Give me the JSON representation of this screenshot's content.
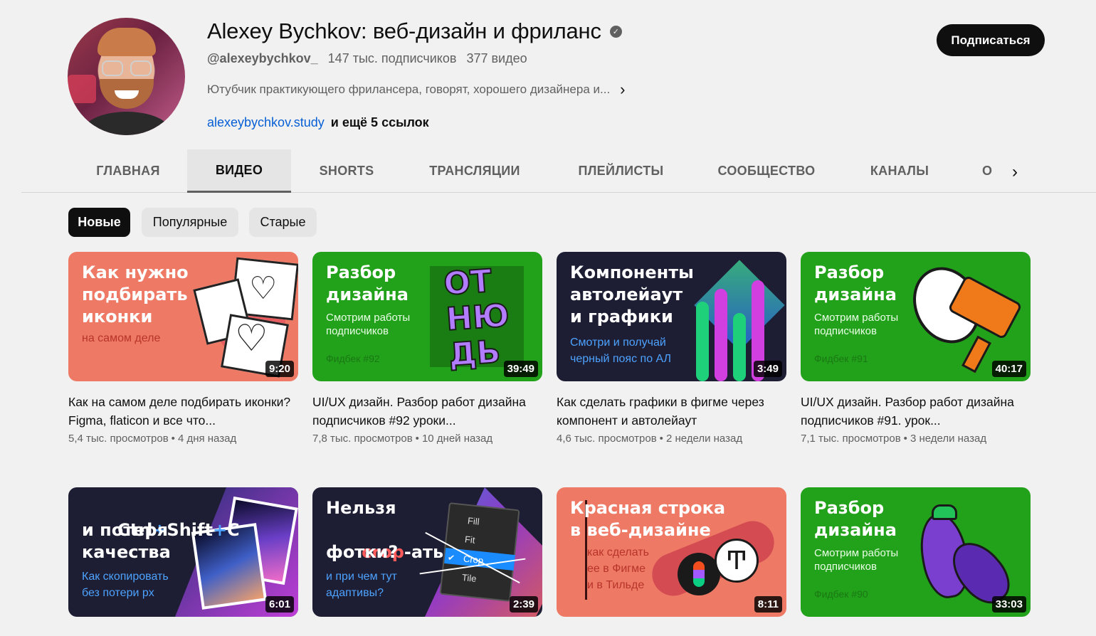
{
  "channel": {
    "title": "Alexey Bychkov: веб-дизайн и фриланс",
    "verified_glyph": "✓",
    "handle": "@alexeybychkov_",
    "subscribers": "147 тыс. подписчиков",
    "videos_count": "377 видео",
    "description": "Ютубчик практикующего фрилансера, говорят, хорошего дизайнера и...",
    "link": "alexeybychkov.study",
    "more_links": "и ещё 5 ссылок",
    "subscribe_label": "Подписаться"
  },
  "tabs": [
    {
      "label": "ГЛАВНАЯ"
    },
    {
      "label": "ВИДЕО"
    },
    {
      "label": "SHORTS"
    },
    {
      "label": "ТРАНСЛЯЦИИ"
    },
    {
      "label": "ПЛЕЙЛИСТЫ"
    },
    {
      "label": "СООБЩЕСТВО"
    },
    {
      "label": "КАНАЛЫ"
    },
    {
      "label": "О"
    }
  ],
  "chips": [
    {
      "label": "Новые"
    },
    {
      "label": "Популярные"
    },
    {
      "label": "Старые"
    }
  ],
  "videos": [
    {
      "thumb_title": "Как нужно\nподбирать\nиконки",
      "thumb_sub": "на самом деле",
      "duration": "9:20",
      "title": "Как на самом деле подбирать иконки? Figma, flaticon и все что...",
      "views": "5,4 тыс. просмотров",
      "age": "4 дня назад"
    },
    {
      "thumb_title": "Разбор\nдизайна",
      "thumb_sub": "Смотрим работы\nподписчиков",
      "thumb_tag": "Фидбек #92",
      "thumb_art": "ОТ\nНЮ\nДЬ",
      "duration": "39:49",
      "title": "UI/UX дизайн. Разбор работ дизайна подписчиков #92 уроки...",
      "views": "7,8 тыс. просмотров",
      "age": "10 дней назад"
    },
    {
      "thumb_title": "Компоненты\nавтолейаут\nи графики",
      "thumb_sub": "Смотри и получай\nчерный пояс по АЛ",
      "duration": "3:49",
      "title": "Как сделать графики в фигме через компонент и автолейаут",
      "views": "4,6 тыс. просмотров",
      "age": "2 недели назад"
    },
    {
      "thumb_title": "Разбор\nдизайна",
      "thumb_sub": "Смотрим работы\nподписчиков",
      "thumb_tag": "Фидбек #91",
      "duration": "40:17",
      "title": "UI/UX дизайн. Разбор работ дизайна подписчиков #91. урок...",
      "views": "7,1 тыс. просмотров",
      "age": "3 недели назад"
    },
    {
      "thumb_title_a": "Ctrl",
      "thumb_title_b": "Shift",
      "thumb_title_c": "C",
      "thumb_plus": "+",
      "thumb_title": "и потеря\nкачества",
      "thumb_sub": "Как скопировать\nбез потери px",
      "duration": "6:01"
    },
    {
      "thumb_title_a": "Нельзя",
      "thumb_title_b": "crop",
      "thumb_title_c": "-ать",
      "thumb_title": "фотки?",
      "thumb_sub": "и при чем тут\nадаптивы?",
      "menu": [
        "Fill",
        "Fit",
        "Crop",
        "Tile"
      ],
      "menu_check": "✔",
      "duration": "2:39"
    },
    {
      "thumb_title": "Красная строка\nв веб-дизайне",
      "thumb_sub": "как сделать\nее в Фигме\nи в Тильде",
      "tilda_glyph": "Ͳ",
      "duration": "8:11"
    },
    {
      "thumb_title": "Разбор\nдизайна",
      "thumb_sub": "Смотрим работы\nподписчиков",
      "thumb_tag": "Фидбек #90",
      "duration": "33:03"
    }
  ],
  "icons": {
    "chevron": "›"
  },
  "colors": {
    "link": "#065fd4",
    "subscribe_bg": "#0f0f0f",
    "coral": "#ee7a66",
    "green": "#22a11a",
    "dark": "#1d1d33",
    "purple": "#9a4bff",
    "blue_accent": "#4da3ff"
  }
}
